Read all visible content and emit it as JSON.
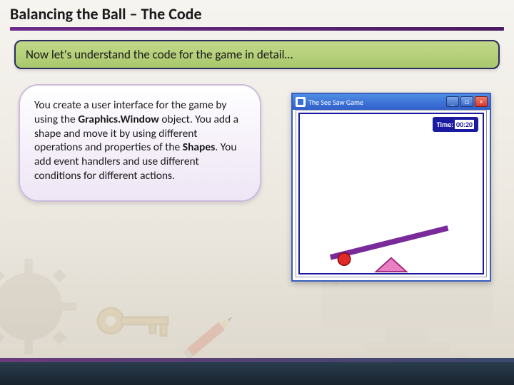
{
  "title": "Balancing the Ball – The Code",
  "callout": "Now let's understand the code for the game in detail…",
  "textbox": {
    "p1a": "You create a user interface for the game by using the ",
    "b1": "Graphics.Window",
    "p1b": " object. You add a shape and move it by using different operations and properties of the ",
    "b2": "Shapes",
    "p1c": ". You add event handlers and use different conditions for different actions."
  },
  "game_window": {
    "title": "The See Saw Game",
    "time_label": "Time:",
    "time_value": "00:20",
    "min_btn": "_",
    "max_btn": "□",
    "close_btn": "×"
  },
  "bg_number": "4",
  "colors": {
    "accent": "#6d2c8a",
    "green": "#a9c86c",
    "blue": "#2f5fc9"
  }
}
